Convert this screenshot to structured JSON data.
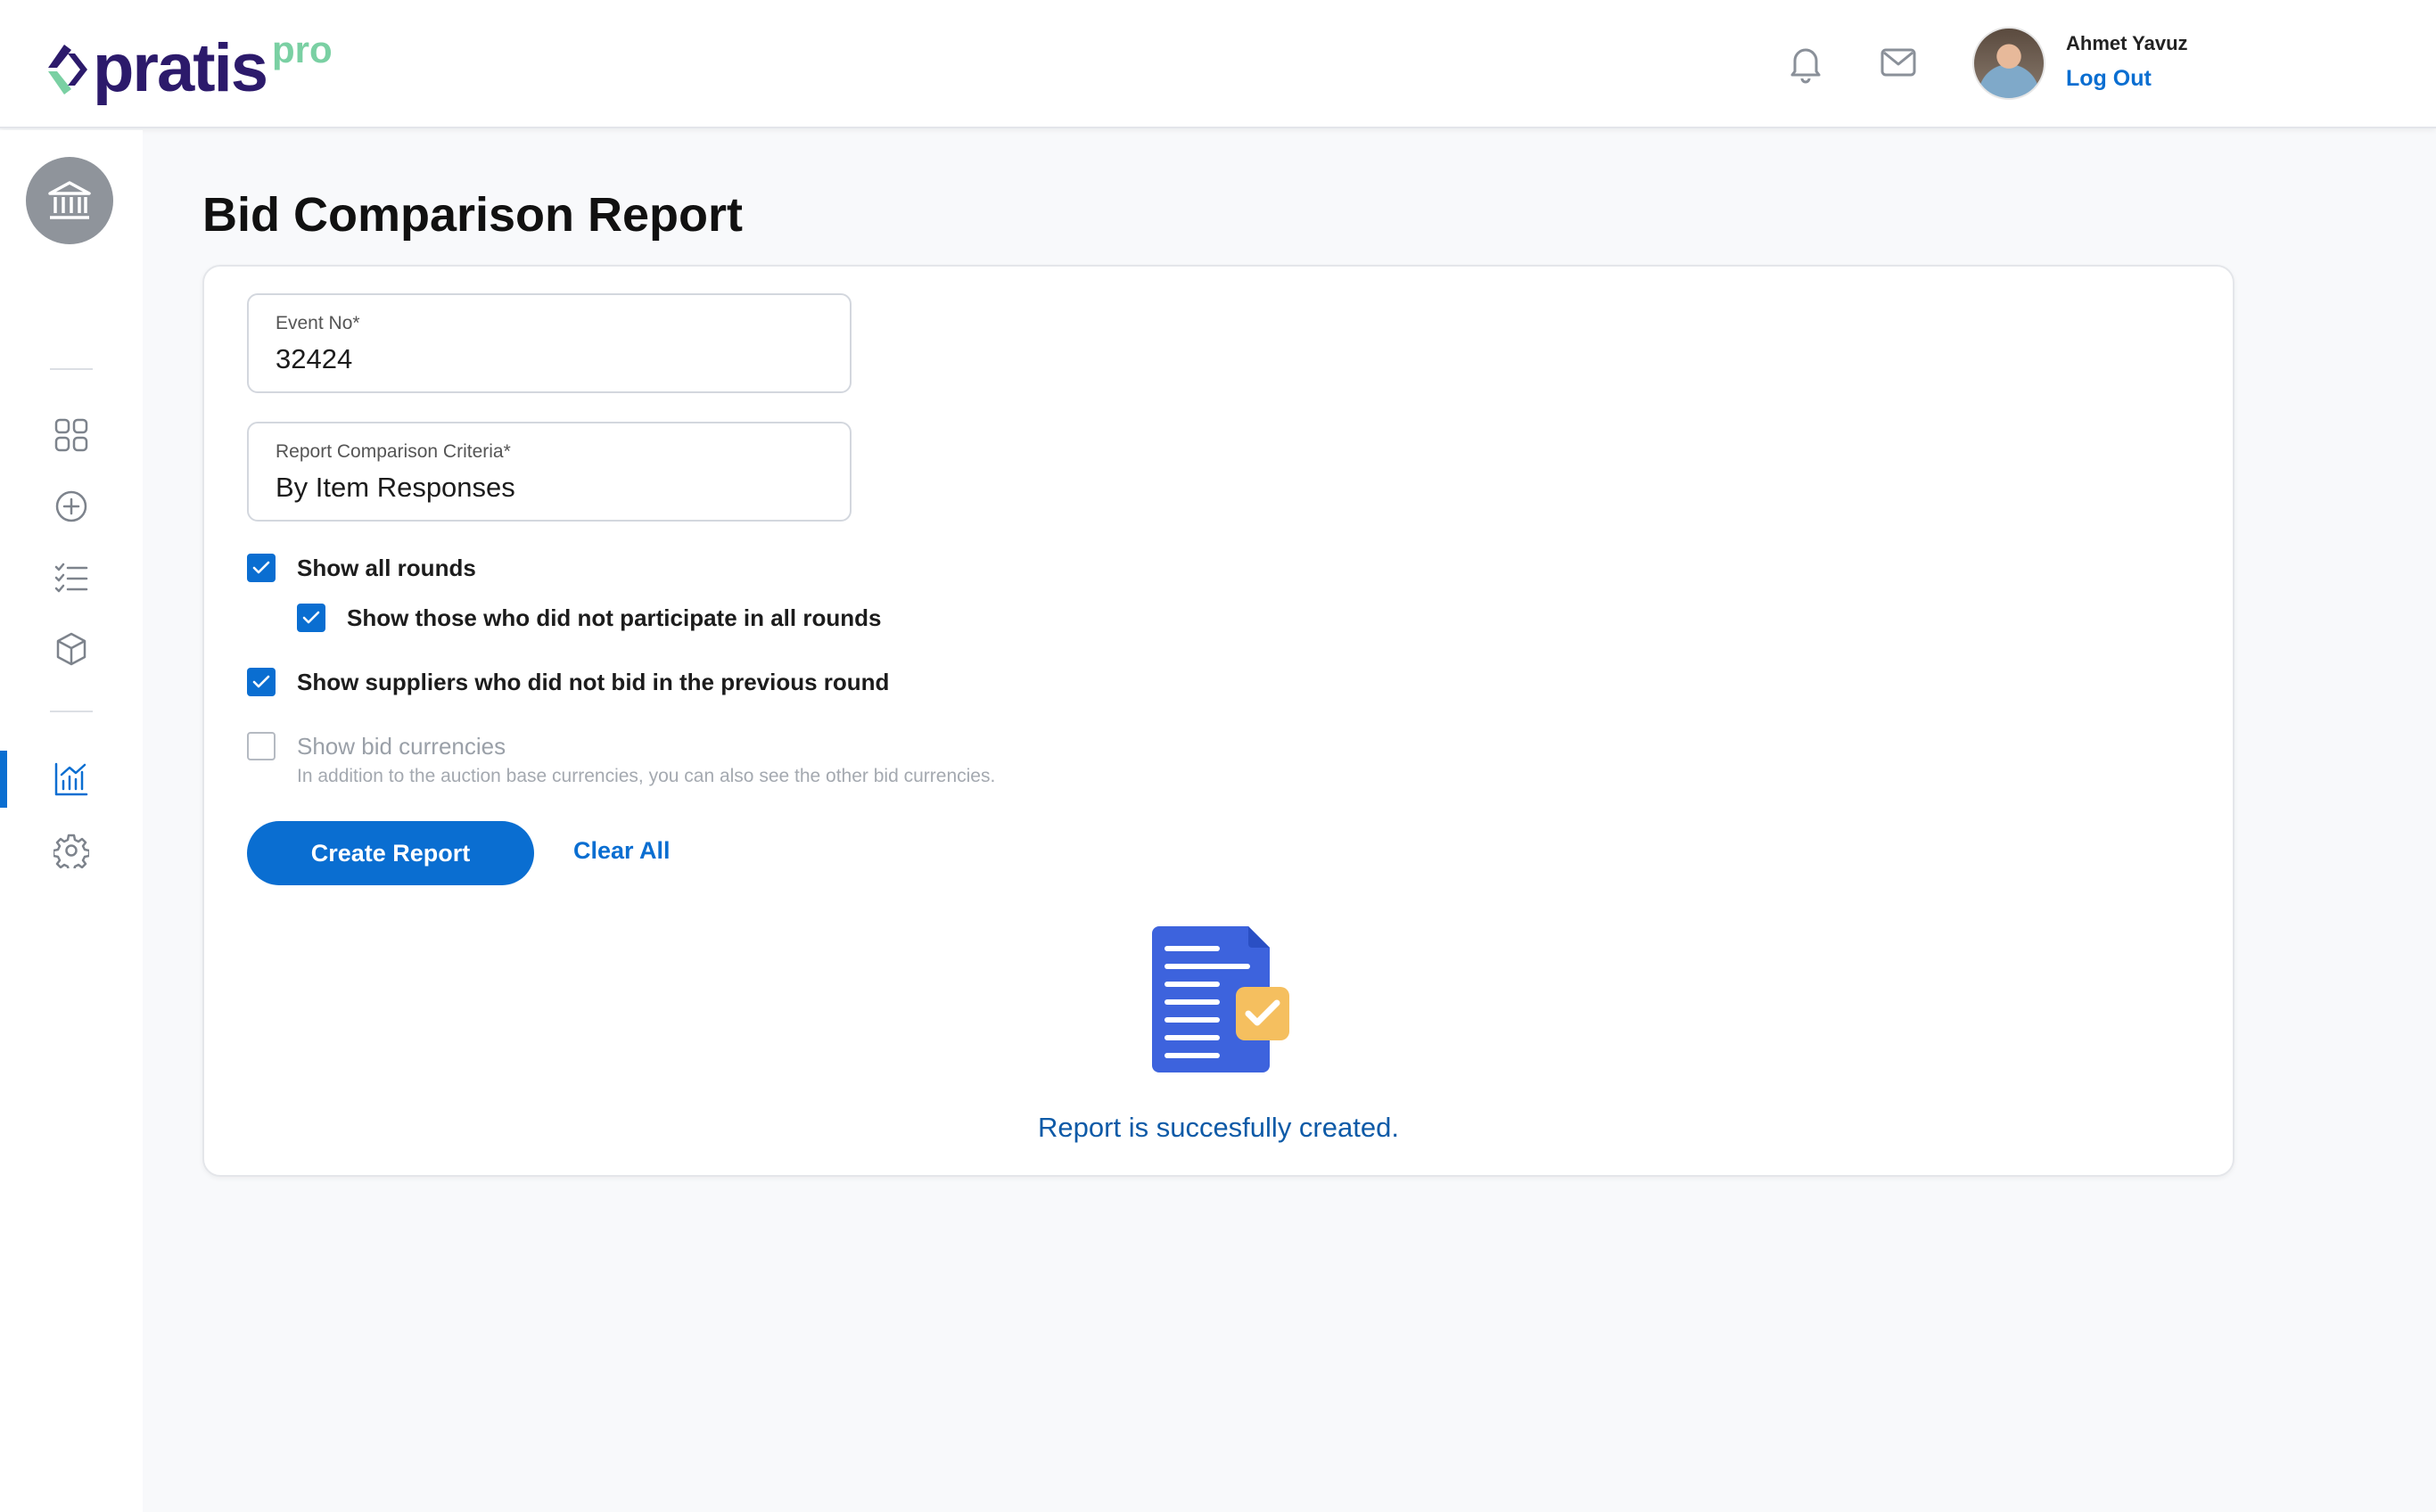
{
  "header": {
    "logo_text": "pratis",
    "logo_suffix": "pro",
    "user_name": "Ahmet Yavuz",
    "logout_label": "Log Out"
  },
  "icons": {
    "notification": "bell-icon",
    "messages": "mail-icon",
    "organization": "bank-icon",
    "nav": [
      "grid-icon",
      "plus-circle-icon",
      "checklist-icon",
      "box-icon",
      "bar-chart-icon",
      "gear-icon"
    ],
    "illustration": "document-check-icon"
  },
  "colors": {
    "accent": "#0a6ed1",
    "brand": "#2c1a6b",
    "brand_secondary": "#7ad0a3",
    "illustration_doc": "#3d63dd",
    "illustration_badge": "#f5bf5f",
    "success_text": "#0d5aa7"
  },
  "main": {
    "title": "Bid Comparison Report",
    "event_no": {
      "label": "Event No*",
      "value": "32424"
    },
    "criteria": {
      "label": "Report Comparison Criteria*",
      "value": "By Item Responses"
    },
    "options": [
      {
        "label": "Show all rounds",
        "checked": true
      },
      {
        "label": "Show those who did not participate in all rounds",
        "checked": true
      },
      {
        "label": "Show suppliers who did not bid in the previous round",
        "checked": true
      },
      {
        "label": "Show bid currencies",
        "checked": false
      }
    ],
    "currency_helper": "In addition to the auction base currencies, you can also see the other bid currencies.",
    "create_label": "Create Report",
    "clear_label": "Clear All",
    "success_message": "Report is succesfully created."
  }
}
